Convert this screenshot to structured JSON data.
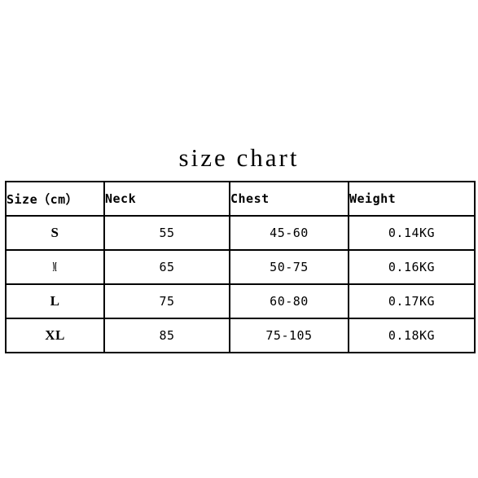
{
  "page": {
    "background_color": "#ffffff",
    "text_color": "#000000",
    "border_color": "#000000"
  },
  "title": {
    "text": "size chart"
  },
  "table": {
    "columns": [
      {
        "key": "size",
        "header": "Size（cm）"
      },
      {
        "key": "neck",
        "header": "Neck"
      },
      {
        "key": "chest",
        "header": "Chest"
      },
      {
        "key": "weight",
        "header": "Weight"
      }
    ],
    "rows": [
      {
        "size": "S",
        "neck": "55",
        "chest": "45-60",
        "weight": "0.14KG"
      },
      {
        "size": "M",
        "neck": "65",
        "chest": "50-75",
        "weight": "0.16KG"
      },
      {
        "size": "L",
        "neck": "75",
        "chest": "60-80",
        "weight": "0.17KG"
      },
      {
        "size": "XL",
        "neck": "85",
        "chest": "75-105",
        "weight": "0.18KG"
      }
    ]
  }
}
